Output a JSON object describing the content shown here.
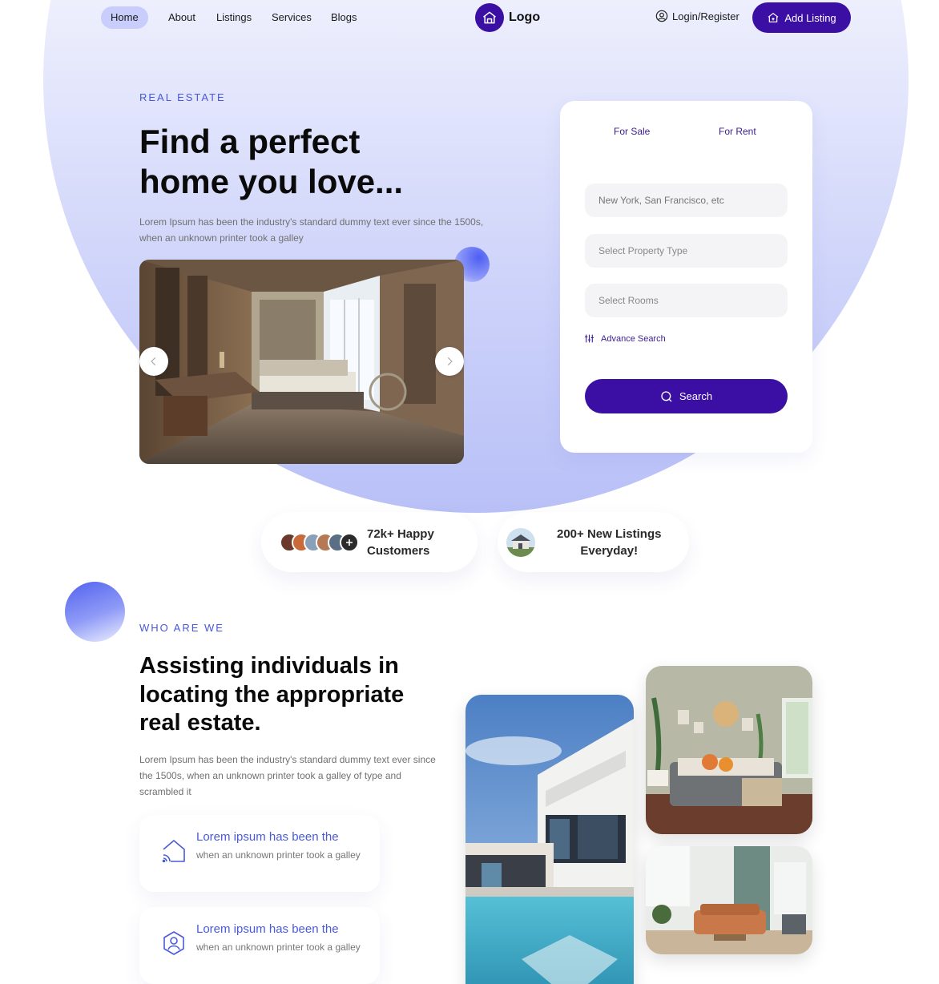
{
  "nav": {
    "items": [
      "Home",
      "About",
      "Listings",
      "Services",
      "Blogs"
    ],
    "logo": "Logo",
    "login": "Login/Register",
    "add_listing": "Add Listing"
  },
  "hero": {
    "eyebrow": "REAL ESTATE",
    "title_line1": "Find a perfect",
    "title_line2": "home you love...",
    "desc": "Lorem Ipsum has been the industry's standard dummy text ever since the 1500s, when an unknown printer took a galley"
  },
  "search": {
    "tab_sale": "For Sale",
    "tab_rent": "For Rent",
    "location_placeholder": "New York, San Francisco, etc",
    "property_type": "Select Property Type",
    "rooms": "Select Rooms",
    "advance": "Advance Search",
    "button": "Search"
  },
  "stats": {
    "customers_line1": "72k+ Happy",
    "customers_line2": "Customers",
    "listings_line1": "200+ New Listings",
    "listings_line2": "Everyday!"
  },
  "about": {
    "eyebrow": "WHO ARE WE",
    "title_line1": "Assisting individuals in",
    "title_line2": "locating the appropriate",
    "title_line3": "real estate.",
    "desc": "Lorem Ipsum has been the industry's standard dummy text ever since the 1500s, when an unknown printer took a galley of type and scrambled it",
    "features": [
      {
        "title": "Lorem ipsum has been the",
        "desc": "when an unknown printer took a galley",
        "icon": "smart-home-icon"
      },
      {
        "title": "Lorem ipsum has been the",
        "desc": "when an unknown printer took a galley",
        "icon": "user-shield-icon"
      }
    ]
  },
  "colors": {
    "primary": "#3b0fa3",
    "accent": "#4957d8",
    "nav_active": "#c9cdfb",
    "blob_light": "#f8f8fe",
    "blob_dark": "#b8c0f7"
  }
}
